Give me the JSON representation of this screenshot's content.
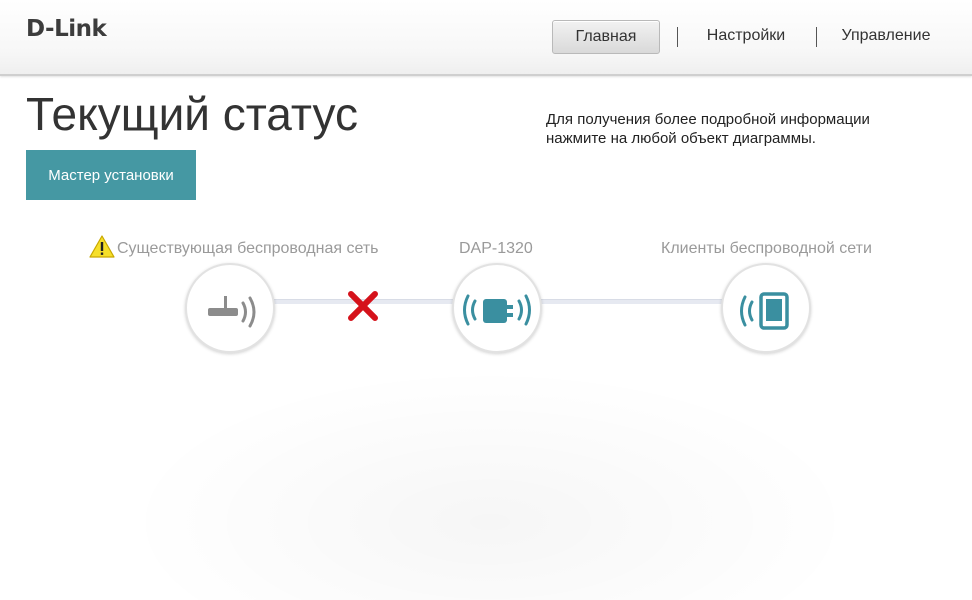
{
  "header": {
    "logo": "D-Link",
    "nav": [
      {
        "label": "Главная",
        "active": true
      },
      {
        "label": "Настройки",
        "active": false
      },
      {
        "label": "Управление",
        "active": false
      }
    ]
  },
  "main": {
    "title": "Текущий статус",
    "info_text": "Для получения более подробной информации нажмите на любой объект диаграммы.",
    "wizard_button": "Мастер установки"
  },
  "diagram": {
    "nodes": [
      {
        "label": "Существующая беспроводная сеть",
        "icon": "router-icon",
        "status": "warning"
      },
      {
        "label": "DAP-1320",
        "icon": "repeater-icon"
      },
      {
        "label": "Клиенты беспроводной сети",
        "icon": "tablet-icon"
      }
    ],
    "link_status": [
      "disconnected",
      "connected"
    ],
    "colors": {
      "accent": "#4598a3",
      "icon_teal": "#3a8fa0",
      "icon_gray": "#8c8c8c",
      "error_red": "#d5121b",
      "warning_yellow": "#f6df2a"
    }
  }
}
